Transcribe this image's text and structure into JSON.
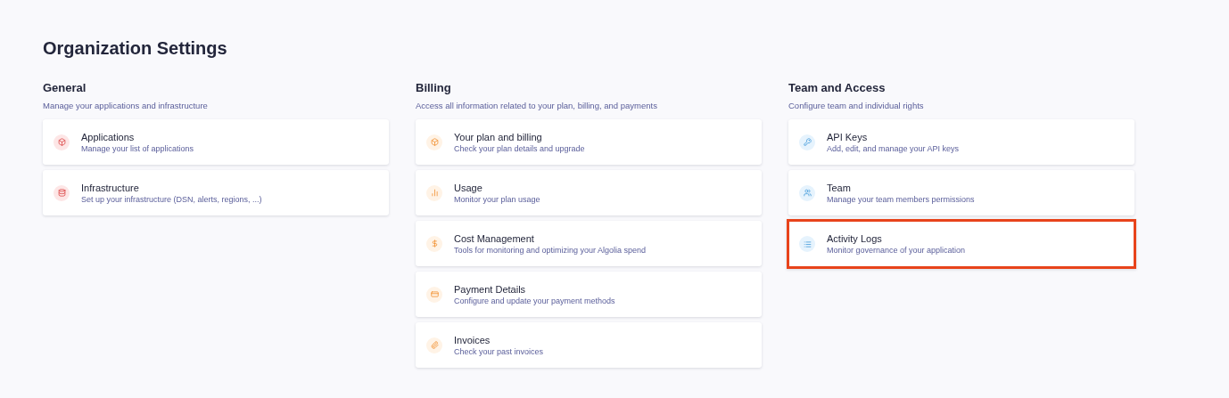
{
  "page": {
    "title": "Organization Settings"
  },
  "sections": [
    {
      "title": "General",
      "description": "Manage your applications and infrastructure",
      "items": [
        {
          "title": "Applications",
          "subtitle": "Manage your list of applications",
          "highlighted": false
        },
        {
          "title": "Infrastructure",
          "subtitle": "Set up your infrastructure (DSN, alerts, regions, ...)",
          "highlighted": false
        }
      ]
    },
    {
      "title": "Billing",
      "description": "Access all information related to your plan, billing, and payments",
      "items": [
        {
          "title": "Your plan and billing",
          "subtitle": "Check your plan details and upgrade",
          "highlighted": false
        },
        {
          "title": "Usage",
          "subtitle": "Monitor your plan usage",
          "highlighted": false
        },
        {
          "title": "Cost Management",
          "subtitle": "Tools for monitoring and optimizing your Algolia spend",
          "highlighted": false
        },
        {
          "title": "Payment Details",
          "subtitle": "Configure and update your payment methods",
          "highlighted": false
        },
        {
          "title": "Invoices",
          "subtitle": "Check your past invoices",
          "highlighted": false
        }
      ]
    },
    {
      "title": "Team and Access",
      "description": "Configure team and individual rights",
      "items": [
        {
          "title": "API Keys",
          "subtitle": "Add, edit, and manage your API keys",
          "highlighted": false
        },
        {
          "title": "Team",
          "subtitle": "Manage your team members permissions",
          "highlighted": false
        },
        {
          "title": "Activity Logs",
          "subtitle": "Monitor governance of your application",
          "highlighted": true
        }
      ]
    }
  ]
}
